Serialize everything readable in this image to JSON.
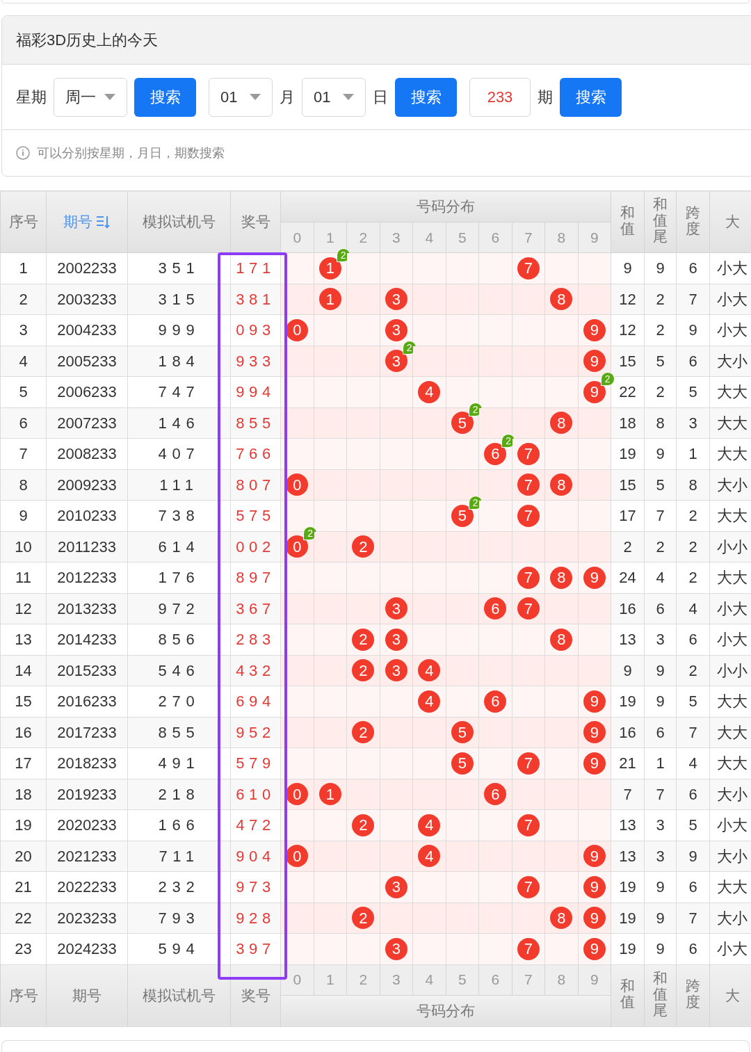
{
  "card": {
    "title": "福彩3D历史上的今天",
    "controls": [
      {
        "kind": "label",
        "text": "星期"
      },
      {
        "kind": "select",
        "value": "周一"
      },
      {
        "kind": "button",
        "text": "搜索"
      },
      {
        "kind": "select",
        "value": "01"
      },
      {
        "kind": "label",
        "text": "月"
      },
      {
        "kind": "select",
        "value": "01"
      },
      {
        "kind": "label",
        "text": "日"
      },
      {
        "kind": "button",
        "text": "搜索"
      },
      {
        "kind": "input",
        "value": "233"
      },
      {
        "kind": "label",
        "text": "期"
      },
      {
        "kind": "button",
        "text": "搜索"
      }
    ],
    "hint": "可以分别按星期，月日，期数搜索"
  },
  "table": {
    "header": {
      "left": [
        {
          "label": "序号",
          "sorted": false
        },
        {
          "label": "期号",
          "sorted": true
        },
        {
          "label": "模拟试机号",
          "sorted": false
        },
        {
          "label": "奖号",
          "sorted": false
        }
      ],
      "distribution": {
        "label": "号码分布",
        "digits": [
          "0",
          "1",
          "2",
          "3",
          "4",
          "5",
          "6",
          "7",
          "8",
          "9"
        ]
      },
      "right": [
        "和值",
        "和值尾",
        "跨度",
        "大"
      ]
    },
    "rows": [
      {
        "seq": "1",
        "period": "2002233",
        "test": "351",
        "prize": "171",
        "cells": [
          null,
          {
            "digit": "1",
            "badge": "2"
          },
          null,
          null,
          null,
          null,
          null,
          {
            "digit": "7"
          },
          null,
          null
        ],
        "sum": "9",
        "tail": "9",
        "span": "6",
        "size": "小大"
      },
      {
        "seq": "2",
        "period": "2003233",
        "test": "315",
        "prize": "381",
        "cells": [
          null,
          {
            "digit": "1"
          },
          null,
          {
            "digit": "3"
          },
          null,
          null,
          null,
          null,
          {
            "digit": "8"
          },
          null
        ],
        "sum": "12",
        "tail": "2",
        "span": "7",
        "size": "小大"
      },
      {
        "seq": "3",
        "period": "2004233",
        "test": "999",
        "prize": "093",
        "cells": [
          {
            "digit": "0"
          },
          null,
          null,
          {
            "digit": "3"
          },
          null,
          null,
          null,
          null,
          null,
          {
            "digit": "9"
          }
        ],
        "sum": "12",
        "tail": "2",
        "span": "9",
        "size": "小大"
      },
      {
        "seq": "4",
        "period": "2005233",
        "test": "184",
        "prize": "933",
        "cells": [
          null,
          null,
          null,
          {
            "digit": "3",
            "badge": "2"
          },
          null,
          null,
          null,
          null,
          null,
          {
            "digit": "9"
          }
        ],
        "sum": "15",
        "tail": "5",
        "span": "6",
        "size": "大小"
      },
      {
        "seq": "5",
        "period": "2006233",
        "test": "747",
        "prize": "994",
        "cells": [
          null,
          null,
          null,
          null,
          {
            "digit": "4"
          },
          null,
          null,
          null,
          null,
          {
            "digit": "9",
            "badge": "2"
          }
        ],
        "sum": "22",
        "tail": "2",
        "span": "5",
        "size": "大大"
      },
      {
        "seq": "6",
        "period": "2007233",
        "test": "146",
        "prize": "855",
        "cells": [
          null,
          null,
          null,
          null,
          null,
          {
            "digit": "5",
            "badge": "2"
          },
          null,
          null,
          {
            "digit": "8"
          },
          null
        ],
        "sum": "18",
        "tail": "8",
        "span": "3",
        "size": "大大"
      },
      {
        "seq": "7",
        "period": "2008233",
        "test": "407",
        "prize": "766",
        "cells": [
          null,
          null,
          null,
          null,
          null,
          null,
          {
            "digit": "6",
            "badge": "2"
          },
          {
            "digit": "7"
          },
          null,
          null
        ],
        "sum": "19",
        "tail": "9",
        "span": "1",
        "size": "大大"
      },
      {
        "seq": "8",
        "period": "2009233",
        "test": "111",
        "prize": "807",
        "cells": [
          {
            "digit": "0"
          },
          null,
          null,
          null,
          null,
          null,
          null,
          {
            "digit": "7"
          },
          {
            "digit": "8"
          },
          null
        ],
        "sum": "15",
        "tail": "5",
        "span": "8",
        "size": "大小"
      },
      {
        "seq": "9",
        "period": "2010233",
        "test": "738",
        "prize": "575",
        "cells": [
          null,
          null,
          null,
          null,
          null,
          {
            "digit": "5",
            "badge": "2"
          },
          null,
          {
            "digit": "7"
          },
          null,
          null
        ],
        "sum": "17",
        "tail": "7",
        "span": "2",
        "size": "大大"
      },
      {
        "seq": "10",
        "period": "2011233",
        "test": "614",
        "prize": "002",
        "cells": [
          {
            "digit": "0",
            "badge": "2"
          },
          null,
          {
            "digit": "2"
          },
          null,
          null,
          null,
          null,
          null,
          null,
          null
        ],
        "sum": "2",
        "tail": "2",
        "span": "2",
        "size": "小小"
      },
      {
        "seq": "11",
        "period": "2012233",
        "test": "176",
        "prize": "897",
        "cells": [
          null,
          null,
          null,
          null,
          null,
          null,
          null,
          {
            "digit": "7"
          },
          {
            "digit": "8"
          },
          {
            "digit": "9"
          }
        ],
        "sum": "24",
        "tail": "4",
        "span": "2",
        "size": "大大"
      },
      {
        "seq": "12",
        "period": "2013233",
        "test": "972",
        "prize": "367",
        "cells": [
          null,
          null,
          null,
          {
            "digit": "3"
          },
          null,
          null,
          {
            "digit": "6"
          },
          {
            "digit": "7"
          },
          null,
          null
        ],
        "sum": "16",
        "tail": "6",
        "span": "4",
        "size": "小大"
      },
      {
        "seq": "13",
        "period": "2014233",
        "test": "856",
        "prize": "283",
        "cells": [
          null,
          null,
          {
            "digit": "2"
          },
          {
            "digit": "3"
          },
          null,
          null,
          null,
          null,
          {
            "digit": "8"
          },
          null
        ],
        "sum": "13",
        "tail": "3",
        "span": "6",
        "size": "小大"
      },
      {
        "seq": "14",
        "period": "2015233",
        "test": "546",
        "prize": "432",
        "cells": [
          null,
          null,
          {
            "digit": "2"
          },
          {
            "digit": "3"
          },
          {
            "digit": "4"
          },
          null,
          null,
          null,
          null,
          null
        ],
        "sum": "9",
        "tail": "9",
        "span": "2",
        "size": "小小"
      },
      {
        "seq": "15",
        "period": "2016233",
        "test": "270",
        "prize": "694",
        "cells": [
          null,
          null,
          null,
          null,
          {
            "digit": "4"
          },
          null,
          {
            "digit": "6"
          },
          null,
          null,
          {
            "digit": "9"
          }
        ],
        "sum": "19",
        "tail": "9",
        "span": "5",
        "size": "大大"
      },
      {
        "seq": "16",
        "period": "2017233",
        "test": "855",
        "prize": "952",
        "cells": [
          null,
          null,
          {
            "digit": "2"
          },
          null,
          null,
          {
            "digit": "5"
          },
          null,
          null,
          null,
          {
            "digit": "9"
          }
        ],
        "sum": "16",
        "tail": "6",
        "span": "7",
        "size": "大大"
      },
      {
        "seq": "17",
        "period": "2018233",
        "test": "491",
        "prize": "579",
        "cells": [
          null,
          null,
          null,
          null,
          null,
          {
            "digit": "5"
          },
          null,
          {
            "digit": "7"
          },
          null,
          {
            "digit": "9"
          }
        ],
        "sum": "21",
        "tail": "1",
        "span": "4",
        "size": "大大"
      },
      {
        "seq": "18",
        "period": "2019233",
        "test": "218",
        "prize": "610",
        "cells": [
          {
            "digit": "0"
          },
          {
            "digit": "1"
          },
          null,
          null,
          null,
          null,
          {
            "digit": "6"
          },
          null,
          null,
          null
        ],
        "sum": "7",
        "tail": "7",
        "span": "6",
        "size": "大小"
      },
      {
        "seq": "19",
        "period": "2020233",
        "test": "166",
        "prize": "472",
        "cells": [
          null,
          null,
          {
            "digit": "2"
          },
          null,
          {
            "digit": "4"
          },
          null,
          null,
          {
            "digit": "7"
          },
          null,
          null
        ],
        "sum": "13",
        "tail": "3",
        "span": "5",
        "size": "小大"
      },
      {
        "seq": "20",
        "period": "2021233",
        "test": "711",
        "prize": "904",
        "cells": [
          {
            "digit": "0"
          },
          null,
          null,
          null,
          {
            "digit": "4"
          },
          null,
          null,
          null,
          null,
          {
            "digit": "9"
          }
        ],
        "sum": "13",
        "tail": "3",
        "span": "9",
        "size": "大小"
      },
      {
        "seq": "21",
        "period": "2022233",
        "test": "232",
        "prize": "973",
        "cells": [
          null,
          null,
          null,
          {
            "digit": "3"
          },
          null,
          null,
          null,
          {
            "digit": "7"
          },
          null,
          {
            "digit": "9"
          }
        ],
        "sum": "19",
        "tail": "9",
        "span": "6",
        "size": "大大"
      },
      {
        "seq": "22",
        "period": "2023233",
        "test": "793",
        "prize": "928",
        "cells": [
          null,
          null,
          {
            "digit": "2"
          },
          null,
          null,
          null,
          null,
          null,
          {
            "digit": "8"
          },
          {
            "digit": "9"
          }
        ],
        "sum": "19",
        "tail": "9",
        "span": "7",
        "size": "大小"
      },
      {
        "seq": "23",
        "period": "2024233",
        "test": "594",
        "prize": "397",
        "cells": [
          null,
          null,
          null,
          {
            "digit": "3"
          },
          null,
          null,
          null,
          {
            "digit": "7"
          },
          null,
          {
            "digit": "9"
          }
        ],
        "sum": "19",
        "tail": "9",
        "span": "6",
        "size": "小大"
      }
    ],
    "footer": {
      "left": [
        {
          "label": "序号",
          "sorted": false
        },
        {
          "label": "期号",
          "sorted": false
        },
        {
          "label": "模拟试机号",
          "sorted": false
        },
        {
          "label": "奖号",
          "sorted": false
        }
      ],
      "distribution": {
        "label": "号码分布",
        "digits": [
          "0",
          "1",
          "2",
          "3",
          "4",
          "5",
          "6",
          "7",
          "8",
          "9"
        ]
      },
      "right": [
        "和值",
        "和值尾",
        "跨度",
        "大"
      ]
    }
  }
}
